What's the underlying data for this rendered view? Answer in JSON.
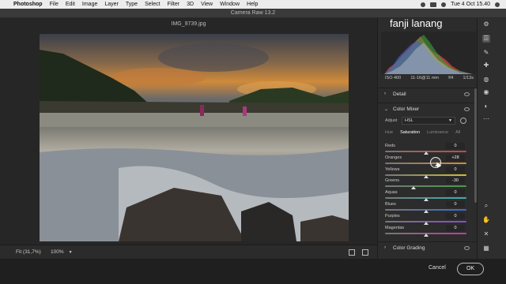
{
  "menubar": {
    "app": "Photoshop",
    "items": [
      "File",
      "Edit",
      "Image",
      "Layer",
      "Type",
      "Select",
      "Filter",
      "3D",
      "View",
      "Window",
      "Help"
    ],
    "clock": "Tue 4 Oct  15.40"
  },
  "window": {
    "title": "Camera Raw 13.2"
  },
  "document": {
    "filename": "IMG_9739.jpg"
  },
  "watermark": "fanji lanang",
  "histogram_info": {
    "iso": "ISO 400",
    "lens": "11-16@11 mm",
    "aperture": "f/4",
    "shutter": "1/13s"
  },
  "sections": {
    "detail": "Detail",
    "color_mixer": "Color Mixer",
    "color_grading": "Color Grading"
  },
  "mixer": {
    "adjust_label": "Adjust",
    "adjust_value": "HSL",
    "tabs": [
      "Hue",
      "Saturation",
      "Luminance",
      "All"
    ],
    "active_tab": "Saturation",
    "sliders": [
      {
        "label": "Reds",
        "value": "0",
        "level": 0
      },
      {
        "label": "Oranges",
        "value": "+28",
        "level": 28
      },
      {
        "label": "Yellows",
        "value": "0",
        "level": 0
      },
      {
        "label": "Greens",
        "value": "-30",
        "level": -30
      },
      {
        "label": "Aquas",
        "value": "0",
        "level": 0
      },
      {
        "label": "Blues",
        "value": "0",
        "level": 0
      },
      {
        "label": "Purples",
        "value": "0",
        "level": 0
      },
      {
        "label": "Magentas",
        "value": "0",
        "level": 0
      }
    ]
  },
  "bottombar": {
    "fit": "Fit (31,7%)",
    "zoom": "100%"
  },
  "footer": {
    "cancel": "Cancel",
    "ok": "OK"
  },
  "tools": [
    "gear-icon",
    "sliders-icon",
    "brush-icon",
    "healing-icon",
    "mask-icon",
    "redeye-icon",
    "presets-icon",
    "more-icon",
    "zoom-icon",
    "hand-icon",
    "sampler-icon",
    "grid-icon"
  ],
  "colors": {
    "reds": "#c44",
    "oranges": "#d98a3a",
    "yellows": "#cbbf3a",
    "greens": "#4a9a4a",
    "aquas": "#3ab0b0",
    "blues": "#3a6ad0",
    "purples": "#8a4ad0",
    "magentas": "#c03aa0"
  }
}
